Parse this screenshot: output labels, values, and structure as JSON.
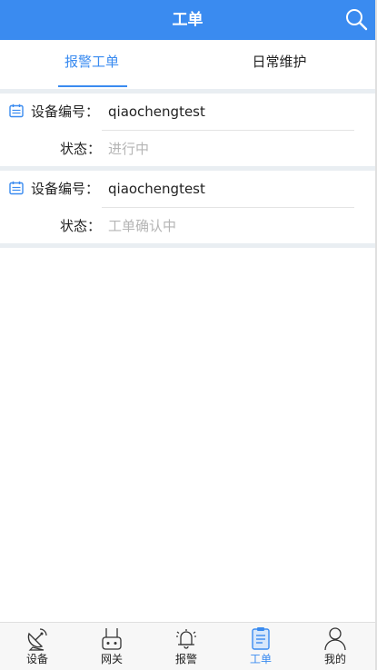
{
  "header": {
    "title": "工单",
    "search_icon": "search-icon"
  },
  "tabs": [
    {
      "label": "报警工单",
      "active": true
    },
    {
      "label": "日常维护",
      "active": false
    }
  ],
  "workorders": [
    {
      "device_label": "设备编号：",
      "device_id": "qiaochengtest",
      "status_label": "状态：",
      "status": "进行中",
      "icon": "calendar-icon"
    },
    {
      "device_label": "设备编号：",
      "device_id": "qiaochengtest",
      "status_label": "状态：",
      "status": "工单确认中",
      "icon": "calendar-icon"
    }
  ],
  "bottom_nav": [
    {
      "label": "设备",
      "icon": "satellite-dish-icon",
      "active": false
    },
    {
      "label": "网关",
      "icon": "router-icon",
      "active": false
    },
    {
      "label": "报警",
      "icon": "bell-icon",
      "active": false
    },
    {
      "label": "工单",
      "icon": "clipboard-icon",
      "active": true
    },
    {
      "label": "我的",
      "icon": "user-icon",
      "active": false
    }
  ],
  "colors": {
    "accent": "#3A8BF0",
    "divider": "#E9EEF2",
    "muted": "#B5B5B5"
  }
}
